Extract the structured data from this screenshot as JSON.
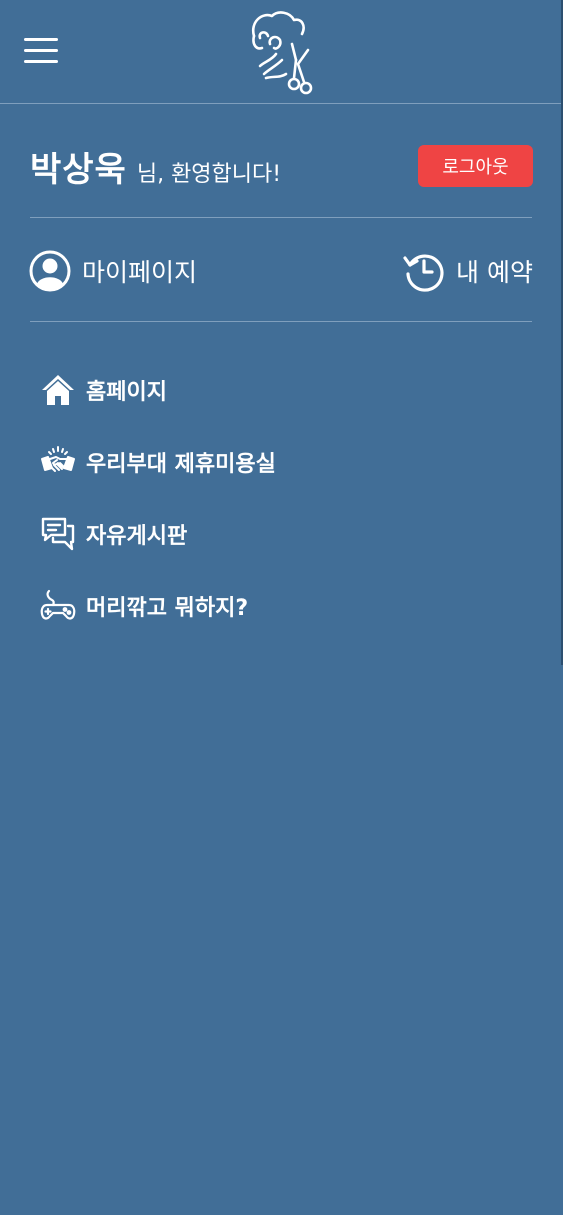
{
  "header": {
    "menu_icon": "hamburger-menu-icon",
    "logo_icon": "barber-scissors-logo-icon"
  },
  "welcome": {
    "user_name": "박상욱",
    "suffix": "님, 환영합니다!",
    "logout_label": "로그아웃"
  },
  "quick_links": [
    {
      "label": "마이페이지",
      "icon": "user-circle-icon"
    },
    {
      "label": "내 예약",
      "icon": "history-clock-icon"
    }
  ],
  "menu": [
    {
      "label": "홈페이지",
      "icon": "home-icon"
    },
    {
      "label": "우리부대 제휴미용실",
      "icon": "handshake-icon"
    },
    {
      "label": "자유게시판",
      "icon": "chat-bubbles-icon"
    },
    {
      "label": "머리깎고 뭐하지?",
      "icon": "gamepad-icon"
    }
  ],
  "colors": {
    "background": "#416e97",
    "logout": "#ef4444",
    "divider": "#7f9fbd",
    "text": "#ffffff"
  }
}
